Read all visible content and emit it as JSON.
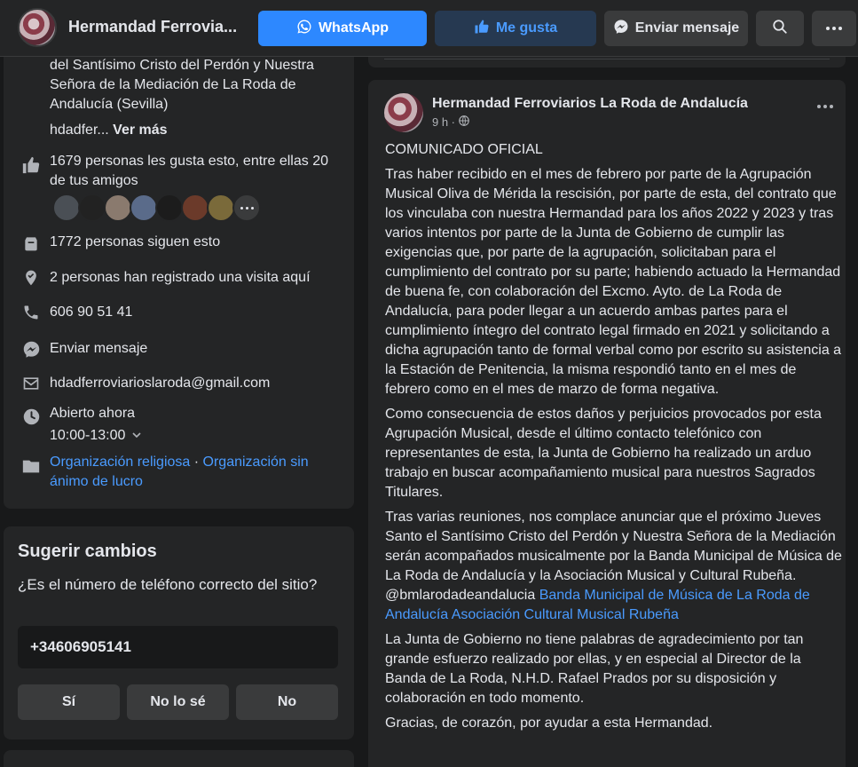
{
  "header": {
    "page_name": "Hermandad Ferrovia...",
    "whatsapp_label": "WhatsApp",
    "like_label": "Me gusta",
    "message_label": "Enviar mensaje"
  },
  "about": {
    "description_tail": "del Santísimo Cristo del Perdón y Nuestra Señora de la Mediación de La Roda de Andalucía (Sevilla)",
    "handle": "hdadfer...",
    "see_more": "Ver más",
    "likes_text": "1679 personas les gusta esto, entre ellas 20 de tus amigos",
    "followers_text": "1772 personas siguen esto",
    "checkins_text": "2 personas han registrado una visita aquí",
    "phone": "606 90 51 41",
    "send_message": "Enviar mensaje",
    "email": "hdadferroviarioslaroda@gmail.com",
    "open_status": "Abierto ahora",
    "hours": "10:00-13:00",
    "category_1": "Organización religiosa",
    "category_separator": " · ",
    "category_2": "Organización sin ánimo de lucro"
  },
  "suggest": {
    "title": "Sugerir cambios",
    "question": "¿Es el número de teléfono correcto del sitio?",
    "phone_value": "+34606905141",
    "yes_label": "Sí",
    "dont_know_label": "No lo sé",
    "no_label": "No"
  },
  "post": {
    "author": "Hermandad Ferroviarios La Roda de Andalucía",
    "time": "9 h ·",
    "heading": "COMUNICADO OFICIAL",
    "p1": "Tras haber recibido en el mes de febrero por parte de la Agrupación Musical Oliva de Mérida la rescisión, por parte de esta, del contrato que los vinculaba con nuestra Hermandad para los años 2022 y 2023 y tras varios intentos por parte de la Junta de Gobierno de cumplir las exigencias que, por parte de la agrupación, solicitaban para el cumplimiento del contrato por su parte; habiendo actuado la Hermandad de buena fe, con colaboración del Excmo. Ayto. de La Roda de Andalucía, para poder llegar a un acuerdo ambas partes para el cumplimiento íntegro del contrato legal firmado en 2021 y solicitando a dicha agrupación tanto de formal verbal como por escrito su asistencia a la Estación de Penitencia, la misma respondió tanto en el mes de febrero como en el mes de marzo de forma negativa.",
    "p2": "Como consecuencia de estos daños y perjuicios provocados por esta Agrupación Musical, desde el último contacto telefónico con representantes de esta, la Junta de Gobierno ha realizado un arduo trabajo en buscar acompañamiento musical para nuestros Sagrados Titulares.",
    "p3": "Tras varias reuniones, nos complace anunciar que el próximo Jueves Santo el Santísimo Cristo del Perdón y Nuestra Señora de la Mediación serán acompañados musicalmente por la Banda Municipal de Música de La Roda de Andalucía y la Asociación Musical y  Cultural Rubeña. @bmlarodadeandalucia",
    "p3_link_1": "Banda Municipal de Música de La Roda de Andalucía",
    "p3_link_2": "Asociación Cultural Musical Rubeña",
    "p4": "La Junta de Gobierno no tiene palabras de agradecimiento por tan grande esfuerzo realizado por ellas, y en especial al Director de la Banda de La Roda, N.H.D. Rafael Prados por su disposición y colaboración en todo momento.",
    "p5": "Gracias, de corazón, por ayudar a esta Hermandad."
  },
  "colors": {
    "background": "#18191a",
    "card": "#242526",
    "accent": "#2d88ff",
    "link": "#4a9bff",
    "open_green": "#45bd62"
  }
}
